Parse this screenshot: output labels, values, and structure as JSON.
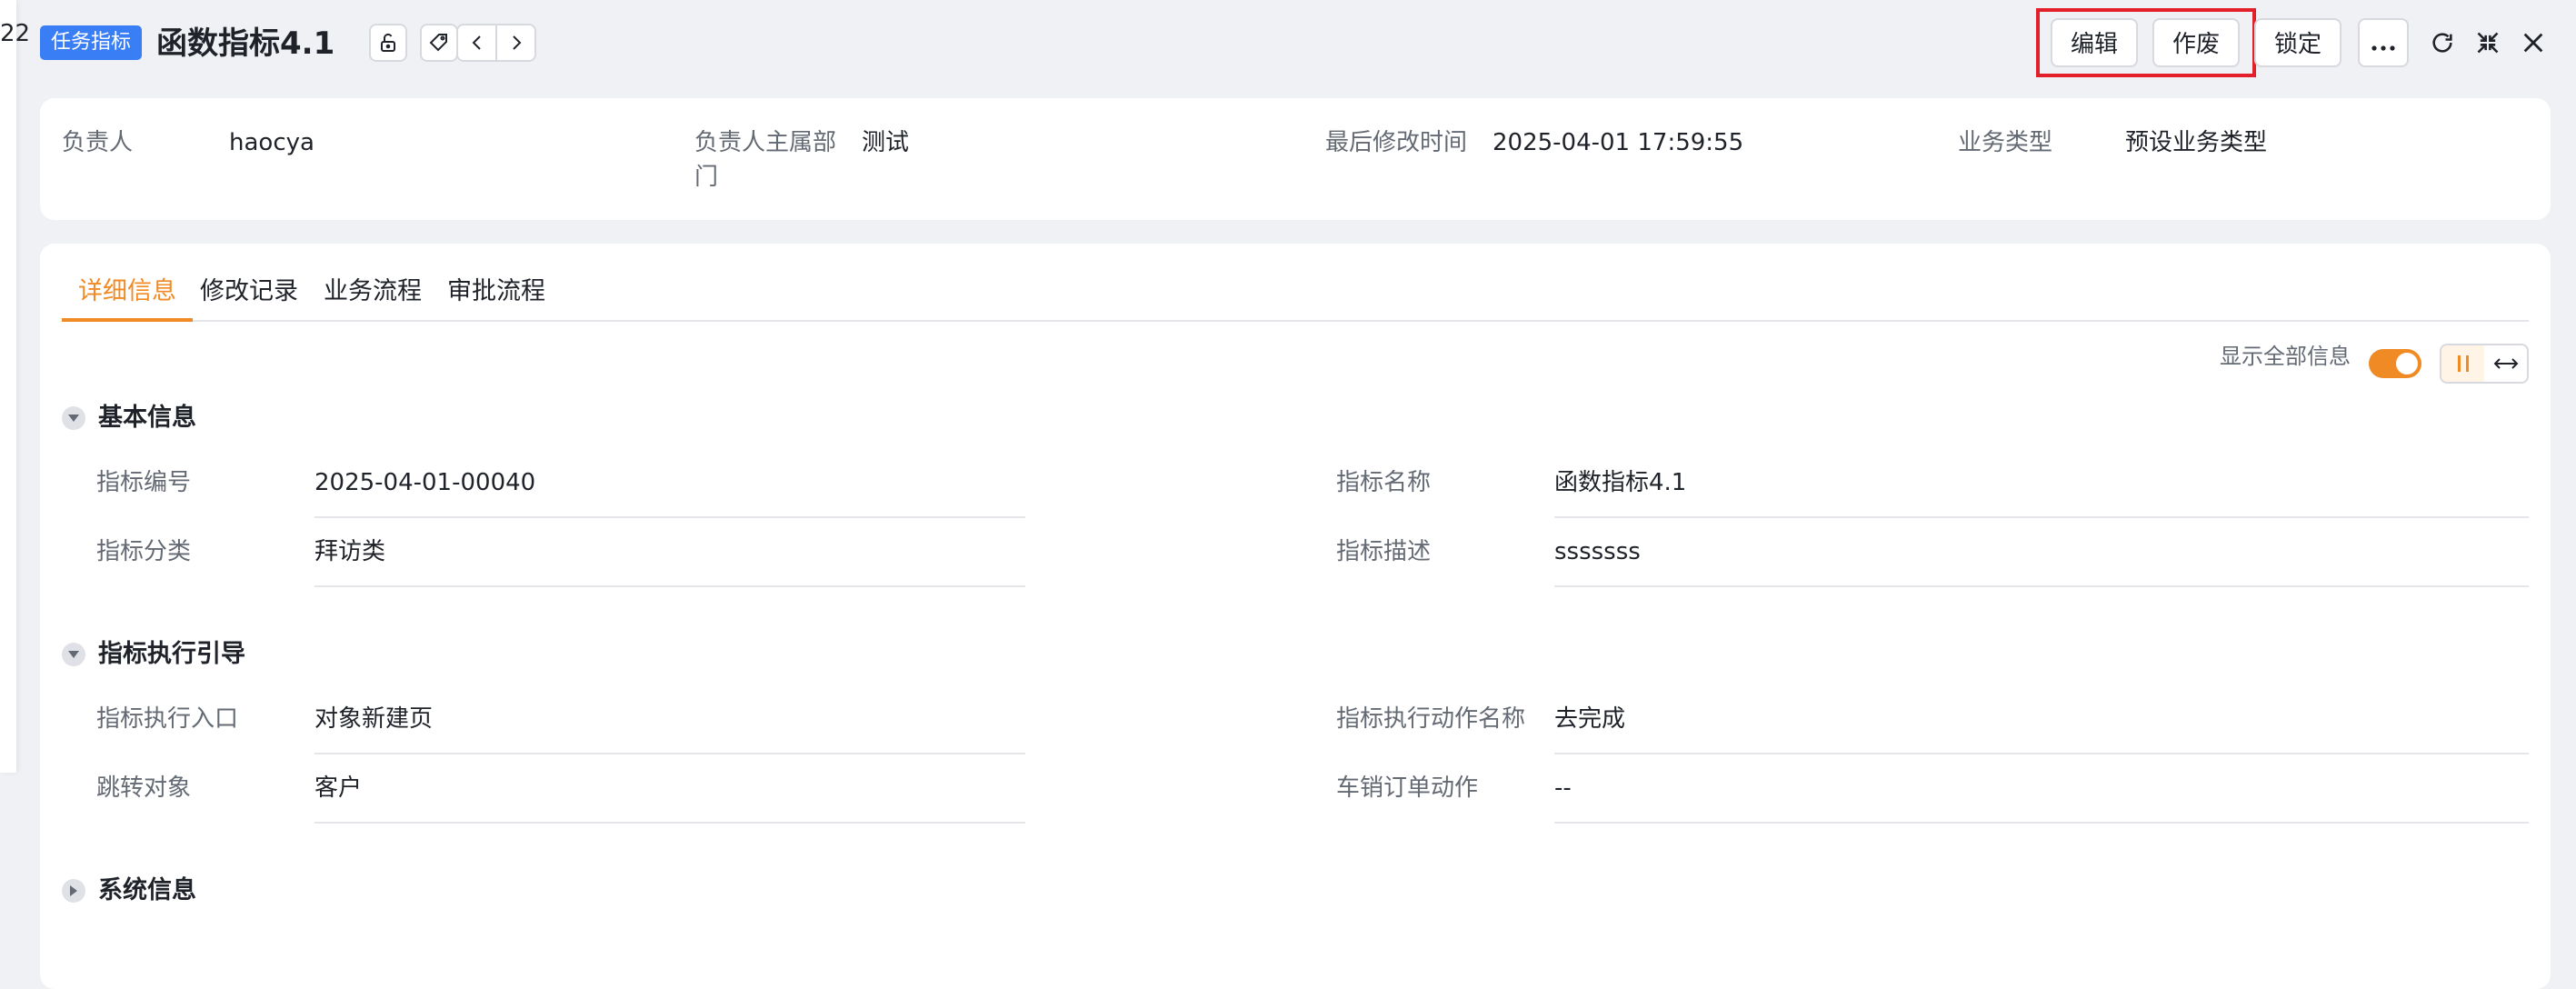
{
  "left_fragment": "22",
  "header": {
    "tag": "任务指标",
    "title": "函数指标4.1",
    "actions": {
      "edit": "编辑",
      "void": "作废",
      "lock": "锁定"
    },
    "icons": [
      "unlock-icon",
      "tag-icon",
      "chevron-left-icon",
      "chevron-right-icon",
      "more-icon",
      "refresh-icon",
      "collapse-icon",
      "close-icon"
    ]
  },
  "summary": {
    "owner_label": "负责人",
    "owner": "haocya",
    "dept_label": "负责人主属部门",
    "dept": "测试",
    "modified_label": "最后修改时间",
    "modified": "2025-04-01 17:59:55",
    "biz_type_label": "业务类型",
    "biz_type": "预设业务类型"
  },
  "tabs": [
    "详细信息",
    "修改记录",
    "业务流程",
    "审批流程"
  ],
  "show_all_label": "显示全部信息",
  "accent": "#f08a24",
  "sections": {
    "basic": {
      "title": "基本信息",
      "code_label": "指标编号",
      "code": "2025-04-01-00040",
      "name_label": "指标名称",
      "name": "函数指标4.1",
      "category_label": "指标分类",
      "category": "拜访类",
      "desc_label": "指标描述",
      "desc": "sssssss"
    },
    "guide": {
      "title": "指标执行引导",
      "entry_label": "指标执行入口",
      "entry": "对象新建页",
      "action_label": "指标执行动作名称",
      "action": "去完成",
      "target_label": "跳转对象",
      "target": "客户",
      "cancel_label": "车销订单动作",
      "cancel": "--"
    },
    "system": {
      "title": "系统信息"
    }
  }
}
